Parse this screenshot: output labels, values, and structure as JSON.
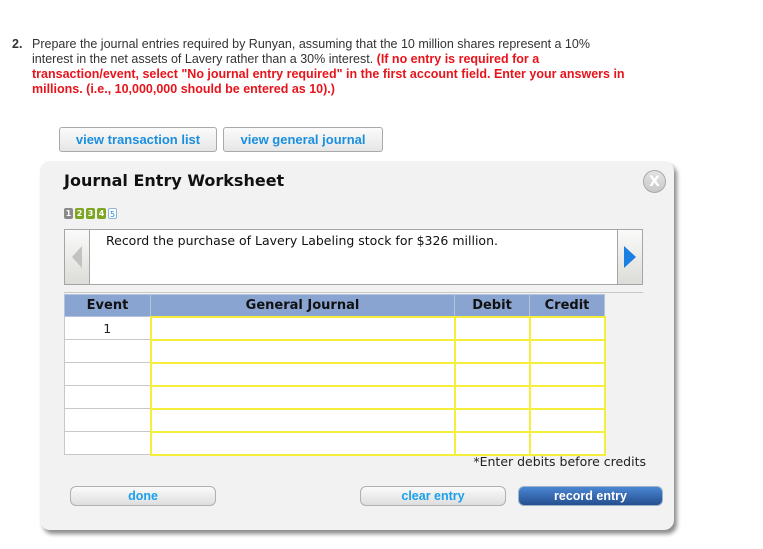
{
  "question": {
    "number": "2.",
    "text": "Prepare the journal entries required by Runyan, assuming that the 10 million shares represent a 10% interest in the net assets of Lavery rather than a 30% interest.",
    "instructions": "(If no entry is required for a transaction/event, select \"No journal entry required\" in the first account field. Enter your answers in millions. (i.e., 10,000,000 should be entered as 10).)"
  },
  "top_buttons": {
    "transaction_list": "view transaction list",
    "general_journal": "view general journal"
  },
  "worksheet": {
    "title": "Journal Entry Worksheet",
    "close_label": "X",
    "steps": [
      {
        "label": "1",
        "state": "visited"
      },
      {
        "label": "2",
        "state": "completed"
      },
      {
        "label": "3",
        "state": "completed"
      },
      {
        "label": "4",
        "state": "completed"
      },
      {
        "label": "5",
        "state": "current"
      }
    ],
    "description": "Record the purchase of Lavery Labeling stock for $326 million.",
    "table": {
      "headers": [
        "Event",
        "General Journal",
        "Debit",
        "Credit"
      ],
      "rows": [
        {
          "event": "1",
          "account": "",
          "debit": "",
          "credit": ""
        },
        {
          "event": "",
          "account": "",
          "debit": "",
          "credit": ""
        },
        {
          "event": "",
          "account": "",
          "debit": "",
          "credit": ""
        },
        {
          "event": "",
          "account": "",
          "debit": "",
          "credit": ""
        },
        {
          "event": "",
          "account": "",
          "debit": "",
          "credit": ""
        },
        {
          "event": "",
          "account": "",
          "debit": "",
          "credit": ""
        }
      ]
    },
    "note": "*Enter debits before credits",
    "buttons": {
      "done": "done",
      "clear": "clear entry",
      "record": "record entry"
    }
  },
  "colors": {
    "instruction_red": "#e8141b",
    "link_blue": "#1a8fe0",
    "header_blue": "#8aa4d2",
    "input_yellow": "#f5ee3a",
    "step_green": "#7ca624",
    "record_button": "#2f63a8"
  }
}
